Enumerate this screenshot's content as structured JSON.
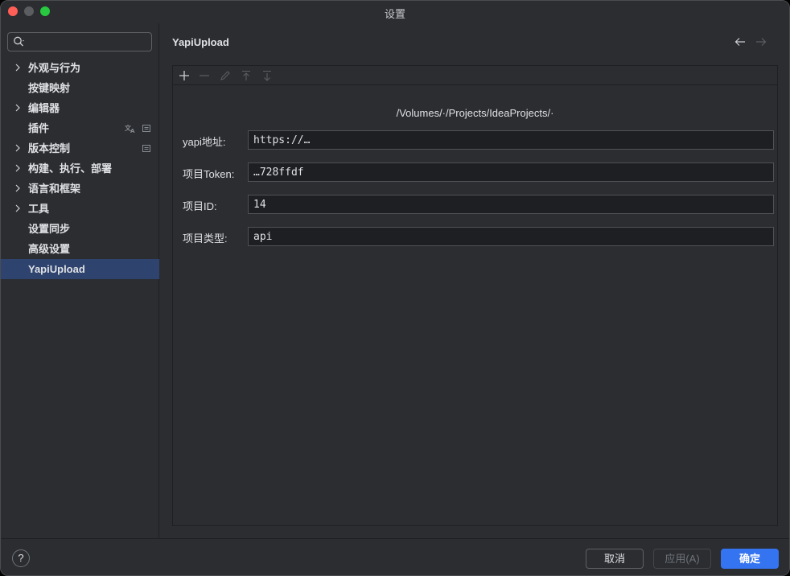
{
  "window": {
    "title": "设置"
  },
  "search": {
    "placeholder": "",
    "value": ""
  },
  "sidebar": {
    "items": [
      {
        "label": "外观与行为",
        "expandable": true
      },
      {
        "label": "按键映射",
        "expandable": false
      },
      {
        "label": "编辑器",
        "expandable": true
      },
      {
        "label": "插件",
        "expandable": false,
        "badges": [
          "translate-icon",
          "settings-badge-icon"
        ]
      },
      {
        "label": "版本控制",
        "expandable": true,
        "badges": [
          "settings-badge-icon"
        ]
      },
      {
        "label": "构建、执行、部署",
        "expandable": true
      },
      {
        "label": "语言和框架",
        "expandable": true
      },
      {
        "label": "工具",
        "expandable": true
      },
      {
        "label": "设置同步",
        "expandable": false
      },
      {
        "label": "高级设置",
        "expandable": false
      },
      {
        "label": "YapiUpload",
        "expandable": false,
        "selected": true
      }
    ]
  },
  "main": {
    "title": "YapiUpload",
    "path": "/Volumes/·/Projects/IdeaProjects/·",
    "fields": [
      {
        "label": "yapi地址:",
        "value": "https://…"
      },
      {
        "label": "项目Token:",
        "value": "…728ffdf"
      },
      {
        "label": "项目ID:",
        "value": "14"
      },
      {
        "label": "项目类型:",
        "value": "api"
      }
    ]
  },
  "footer": {
    "help_label": "?",
    "cancel_label": "取消",
    "apply_label": "应用(A)",
    "ok_label": "确定"
  },
  "colors": {
    "selection": "#2e436e",
    "primary_button": "#3574f0",
    "background": "#2b2d30"
  }
}
